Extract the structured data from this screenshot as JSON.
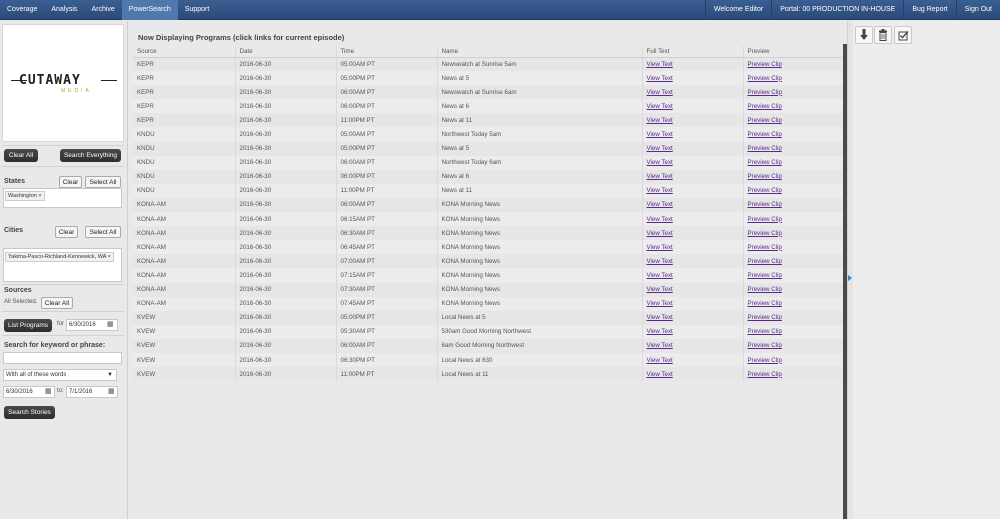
{
  "nav": {
    "left": [
      "Coverage",
      "Analysis",
      "Archive",
      "PowerSearch",
      "Support"
    ],
    "active": "PowerSearch",
    "right": [
      "Welcome Editor",
      "Portal: 00 PRODUCTION IN-HOUSE",
      "Bug Report",
      "Sign Out"
    ]
  },
  "logo": {
    "main": "CUTAWAY",
    "sub": "MEDIA"
  },
  "sidebar": {
    "clear_all": "Clear All",
    "search_everything": "Search Everything",
    "states_label": "States",
    "states_clear": "Clear",
    "states_select_all": "Select All",
    "state_tag": "Washington ×",
    "cities_label": "Cities",
    "cities_clear": "Clear",
    "cities_select_all": "Select All",
    "city_tag": "Yakima-Pasco-Richland-Kennewick, WA ×",
    "sources_label": "Sources",
    "sources_status": "All Selected.",
    "sources_clear_all": "Clear All",
    "list_programs": "List Programs",
    "for_label": "for",
    "date_value": "6/30/2016",
    "keyword_label": "Search for keyword or phrase:",
    "keyword_value": "",
    "match_mode": "With all of these words",
    "from_date": "6/30/2016",
    "to_label": "to:",
    "to_date": "7/1/2016",
    "search_stories": "Search Stories"
  },
  "main": {
    "title": "Now Displaying Programs (click links for current episode)",
    "columns": [
      "Source",
      "Date",
      "Time",
      "Name",
      "Full Text",
      "Preview"
    ],
    "rows": [
      [
        "KEPR",
        "2016-06-30",
        "05:00AM PT",
        "Newswatch at Sunrise 5am",
        "View Text",
        "Preview Clip"
      ],
      [
        "KEPR",
        "2016-06-30",
        "05:00PM PT",
        "News at 5",
        "View Text",
        "Preview Clip"
      ],
      [
        "KEPR",
        "2016-06-30",
        "06:00AM PT",
        "Newswatch at Sunrise 6am",
        "View Text",
        "Preview Clip"
      ],
      [
        "KEPR",
        "2016-06-30",
        "06:00PM PT",
        "News at 6",
        "View Text",
        "Preview Clip"
      ],
      [
        "KEPR",
        "2016-06-30",
        "11:00PM PT",
        "News at 11",
        "View Text",
        "Preview Clip"
      ],
      [
        "KNDU",
        "2016-06-30",
        "05:00AM PT",
        "Northwest Today 5am",
        "View Text",
        "Preview Clip"
      ],
      [
        "KNDU",
        "2016-06-30",
        "05:00PM PT",
        "News at 5",
        "View Text",
        "Preview Clip"
      ],
      [
        "KNDU",
        "2016-06-30",
        "06:00AM PT",
        "Northwest Today 6am",
        "View Text",
        "Preview Clip"
      ],
      [
        "KNDU",
        "2016-06-30",
        "06:00PM PT",
        "News at 6",
        "View Text",
        "Preview Clip"
      ],
      [
        "KNDU",
        "2016-06-30",
        "11:00PM PT",
        "News at 11",
        "View Text",
        "Preview Clip"
      ],
      [
        "KONA-AM",
        "2016-06-30",
        "06:00AM PT",
        "KONA Morning News",
        "View Text",
        "Preview Clip"
      ],
      [
        "KONA-AM",
        "2016-06-30",
        "06:15AM PT",
        "KONA Morning News",
        "View Text",
        "Preview Clip"
      ],
      [
        "KONA-AM",
        "2016-06-30",
        "06:30AM PT",
        "KONA Morning News",
        "View Text",
        "Preview Clip"
      ],
      [
        "KONA-AM",
        "2016-06-30",
        "06:45AM PT",
        "KONA Morning News",
        "View Text",
        "Preview Clip"
      ],
      [
        "KONA-AM",
        "2016-06-30",
        "07:00AM PT",
        "KONA Morning News",
        "View Text",
        "Preview Clip"
      ],
      [
        "KONA-AM",
        "2016-06-30",
        "07:15AM PT",
        "KONA Morning News",
        "View Text",
        "Preview Clip"
      ],
      [
        "KONA-AM",
        "2016-06-30",
        "07:30AM PT",
        "KONA Morning News",
        "View Text",
        "Preview Clip"
      ],
      [
        "KONA-AM",
        "2016-06-30",
        "07:45AM PT",
        "KONA Morning News",
        "View Text",
        "Preview Clip"
      ],
      [
        "KVEW",
        "2016-06-30",
        "05:00PM PT",
        "Local News at 5",
        "View Text",
        "Preview Clip"
      ],
      [
        "KVEW",
        "2016-06-30",
        "05:30AM PT",
        "530am Good Morning Northwest",
        "View Text",
        "Preview Clip"
      ],
      [
        "KVEW",
        "2016-06-30",
        "06:00AM PT",
        "6am Good Morning Northwest",
        "View Text",
        "Preview Clip"
      ],
      [
        "KVEW",
        "2016-06-30",
        "06:30PM PT",
        "Local News at 630",
        "View Text",
        "Preview Clip"
      ],
      [
        "KVEW",
        "2016-06-30",
        "11:00PM PT",
        "Local News at 11",
        "View Text",
        "Preview Clip"
      ]
    ]
  },
  "tools": [
    "download-icon",
    "trash-icon",
    "checkbox-icon"
  ],
  "colors": {
    "nav": "#2f5283",
    "link": "#5a2a8a",
    "accent": "#2a87c9"
  }
}
